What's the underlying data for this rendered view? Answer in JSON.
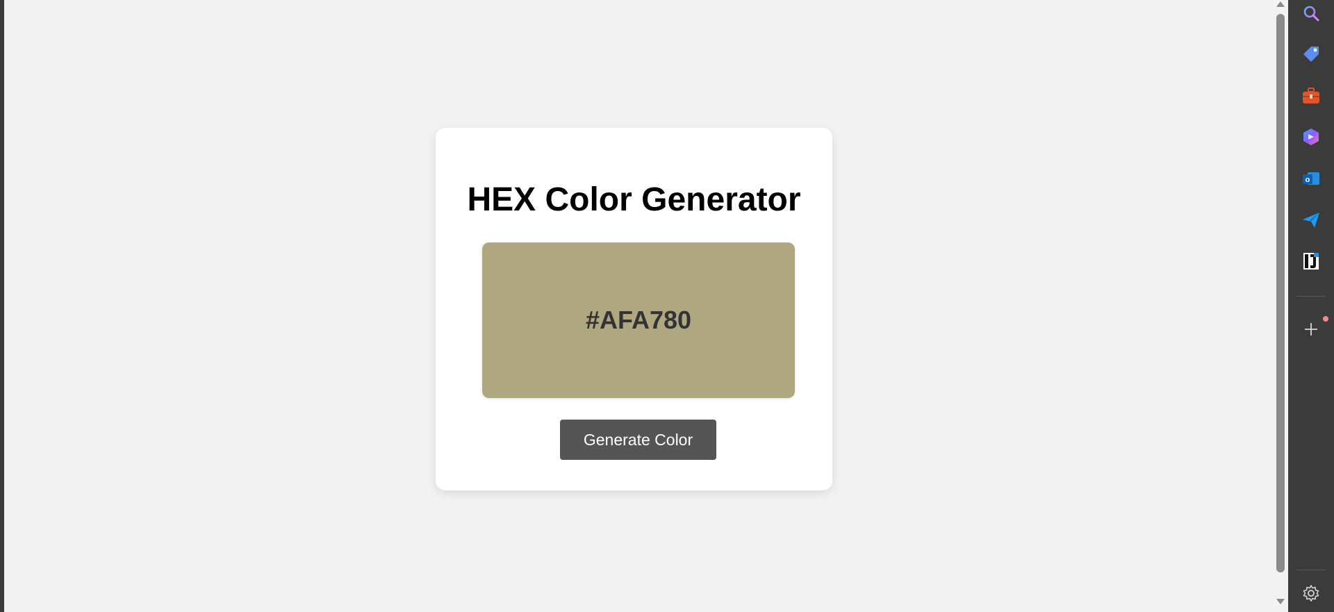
{
  "app": {
    "title": "HEX Color Generator"
  },
  "color_box": {
    "hex": "#AFA780",
    "color": "#AFA780"
  },
  "actions": {
    "generate_label": "Generate Color"
  },
  "sidebar": {
    "items": [
      {
        "name": "search",
        "icon": "search-icon"
      },
      {
        "name": "tag",
        "icon": "tag-icon"
      },
      {
        "name": "toolbox",
        "icon": "toolbox-icon"
      },
      {
        "name": "copilot",
        "icon": "copilot-icon"
      },
      {
        "name": "outlook",
        "icon": "outlook-icon"
      },
      {
        "name": "send",
        "icon": "send-icon"
      },
      {
        "name": "app",
        "icon": "app-icon"
      },
      {
        "name": "add",
        "icon": "plus-icon"
      },
      {
        "name": "settings",
        "icon": "gear-icon"
      }
    ]
  },
  "colors": {
    "page_background": "#F2F2F2",
    "card_background": "#FFFFFF",
    "button_background": "#555555",
    "sidebar_background": "#3B3B3B"
  }
}
